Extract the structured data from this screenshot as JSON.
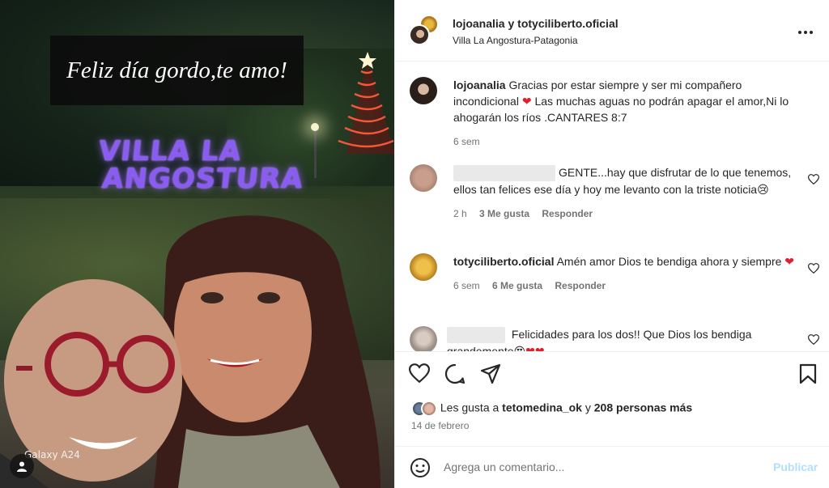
{
  "photo": {
    "caption": "Feliz día gordo,te amo!",
    "sign_line1": "VILLA LA",
    "sign_line2": "ANGOSTURA",
    "watermark": "Galaxy A24"
  },
  "post": {
    "author1": "lojoanalia",
    "connector": " y ",
    "author2": "totyciliberto.oficial",
    "location": "Villa La Angostura-Patagonia",
    "more_icon": "more-horizontal-icon"
  },
  "comments": [
    {
      "user": "lojoanalia",
      "text_a": "Gracias por estar siempre y ser mi compañero incondicional ",
      "text_b": " Las muchas aguas no podrán apagar el amor,Ni lo ahogarán los ríos .CANTARES 8:7",
      "time": "6 sem"
    },
    {
      "user": "",
      "text": "GENTE...hay que disfrutar de lo que tenemos, ellos tan felices ese día y hoy me levanto con la triste noticia😢",
      "time": "2 h",
      "likes": "3 Me gusta",
      "reply": "Responder"
    },
    {
      "user": "totyciliberto.oficial",
      "text": "Amén amor Dios te bendiga ahora y siempre ",
      "time": "6 sem",
      "likes": "6 Me gusta",
      "reply": "Responder"
    },
    {
      "user": "",
      "text": "Felicidades para los dos!! Que Dios los bendiga grandemente😍",
      "time": "",
      "likes": "",
      "reply": ""
    }
  ],
  "likes_bar": {
    "prefix": "Les gusta a ",
    "user": "tetomedina_ok",
    "middle": " y ",
    "count": "208 personas más"
  },
  "date": "14 de febrero",
  "add_comment": {
    "placeholder": "Agrega un comentario...",
    "publish": "Publicar"
  },
  "colors": {
    "heart_red": "#e0202a",
    "publish_disabled": "#b2dffc",
    "muted": "#737373"
  }
}
